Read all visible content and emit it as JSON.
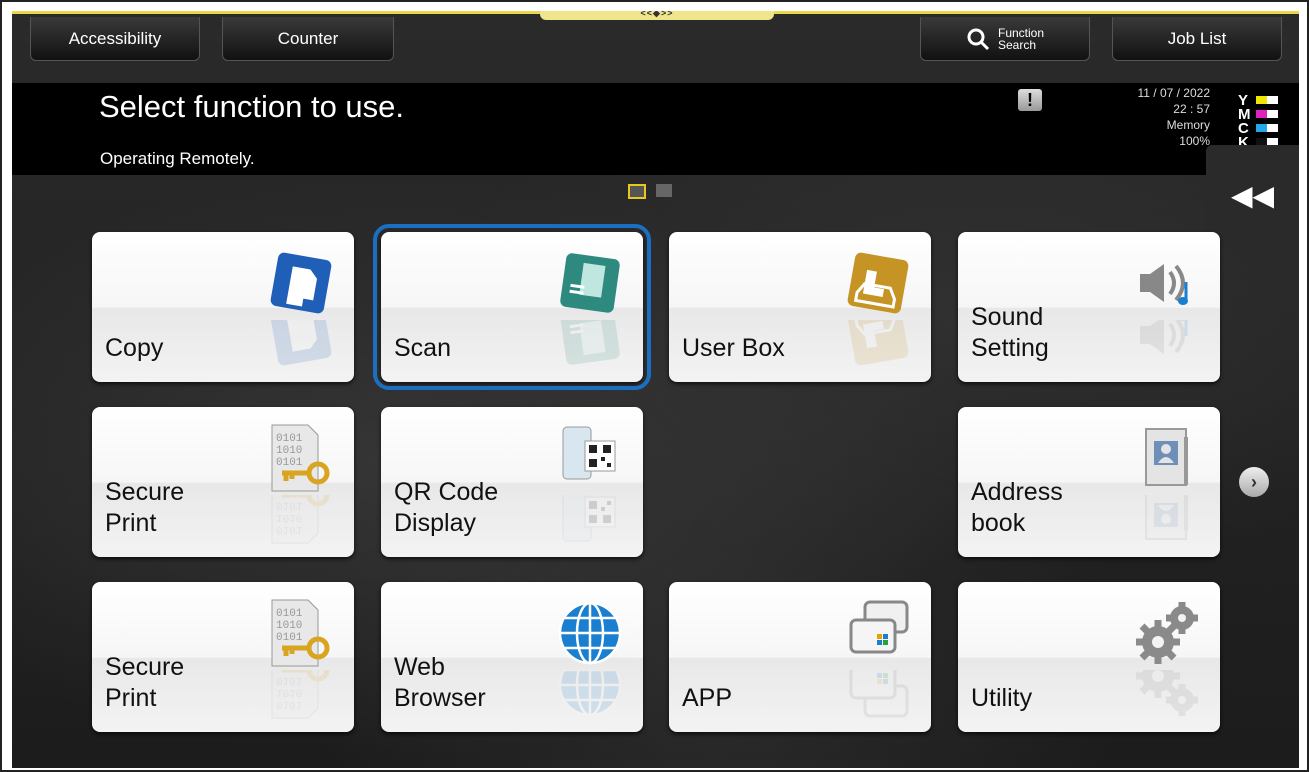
{
  "header": {
    "handle_glyph": "<<◆>>",
    "accessibility_label": "Accessibility",
    "counter_label": "Counter",
    "function_search_line1": "Function",
    "function_search_line2": "Search",
    "job_list_label": "Job List"
  },
  "message": {
    "title": "Select function to use.",
    "subtitle": "Operating Remotely.",
    "alert_glyph": "!"
  },
  "status": {
    "date": "11 / 07 / 2022",
    "time": "22 : 57",
    "memory_label": "Memory",
    "memory_value": "100%"
  },
  "toner": [
    {
      "letter": "Y",
      "color": "#f2e600",
      "level": 0.5
    },
    {
      "letter": "M",
      "color": "#e020c0",
      "level": 0.5
    },
    {
      "letter": "C",
      "color": "#20a8e8",
      "level": 0.5
    },
    {
      "letter": "K",
      "color": "#111111",
      "level": 0.5
    }
  ],
  "pager": {
    "pages": 2,
    "current": 1
  },
  "tiles": [
    {
      "id": "copy",
      "label": "Copy",
      "icon": "copy-icon"
    },
    {
      "id": "scan",
      "label": "Scan",
      "icon": "scan-icon",
      "selected": true
    },
    {
      "id": "user-box",
      "label": "User Box",
      "icon": "user-box-icon"
    },
    {
      "id": "sound-setting",
      "label": "Sound\nSetting",
      "icon": "sound-icon"
    },
    {
      "id": "secure-print-1",
      "label": "Secure\nPrint",
      "icon": "secure-print-icon"
    },
    {
      "id": "qr-code-display",
      "label": "QR Code\nDisplay",
      "icon": "qr-code-icon"
    },
    {
      "id": "address-book",
      "label": "Address\nbook",
      "icon": "address-book-icon"
    },
    {
      "id": "secure-print-2",
      "label": "Secure\nPrint",
      "icon": "secure-print-icon"
    },
    {
      "id": "web-browser",
      "label": "Web\nBrowser",
      "icon": "globe-icon"
    },
    {
      "id": "app",
      "label": "APP",
      "icon": "app-icon"
    },
    {
      "id": "utility",
      "label": "Utility",
      "icon": "gear-icon"
    }
  ],
  "controls": {
    "collapse_glyph": "◀◀",
    "next_page_glyph": "›"
  }
}
